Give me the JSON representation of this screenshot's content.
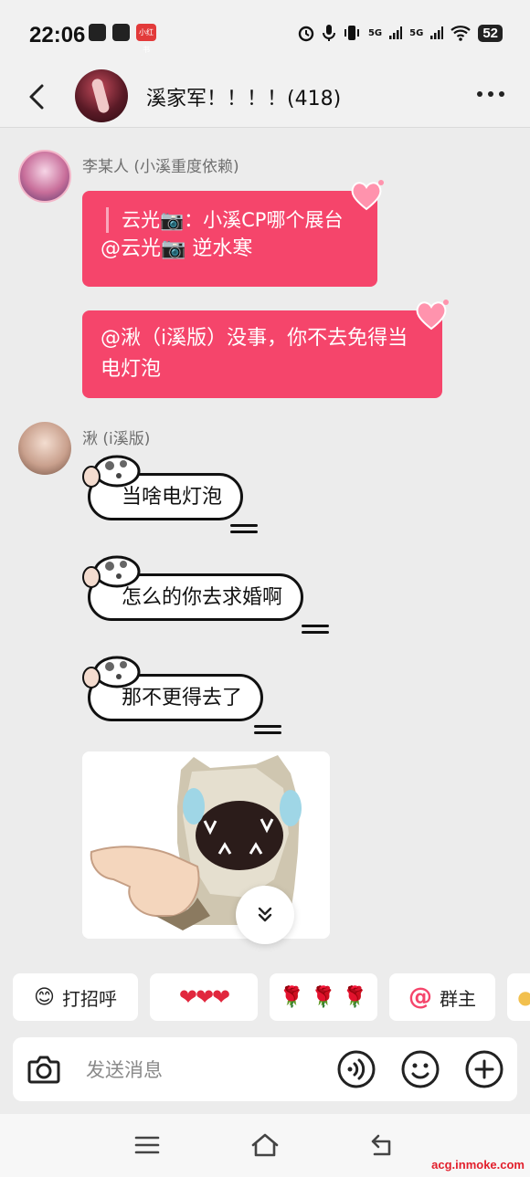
{
  "status": {
    "time": "22:06",
    "app_badge": "小红书",
    "signal_1": "5G",
    "signal_2": "5G",
    "battery": "52"
  },
  "header": {
    "title": "溪家军！！！！(418)"
  },
  "messages": {
    "m1_sender": "李某人 (小溪重度依赖)",
    "m1_quote": "云光📷：小溪CP哪个展台",
    "m1_text": "@云光📷 逆水寒",
    "m2_text": "@湫（i溪版）没事，你不去免得当电灯泡",
    "m3_sender": "湫 (i溪版)",
    "m3_text": "当啥电灯泡",
    "m4_text": "怎么的你去求婚啊",
    "m5_text": "那不更得去了"
  },
  "quick_actions": {
    "greet_emoji": "😊",
    "greet": "打招呼",
    "hearts": "❤❤❤",
    "roses": "🌹 🌹 🌹",
    "at_label": "群主"
  },
  "input": {
    "placeholder": "发送消息"
  },
  "watermark": "acg.inmoke.com",
  "colors": {
    "accent": "#f5456b",
    "background": "#ececec"
  }
}
